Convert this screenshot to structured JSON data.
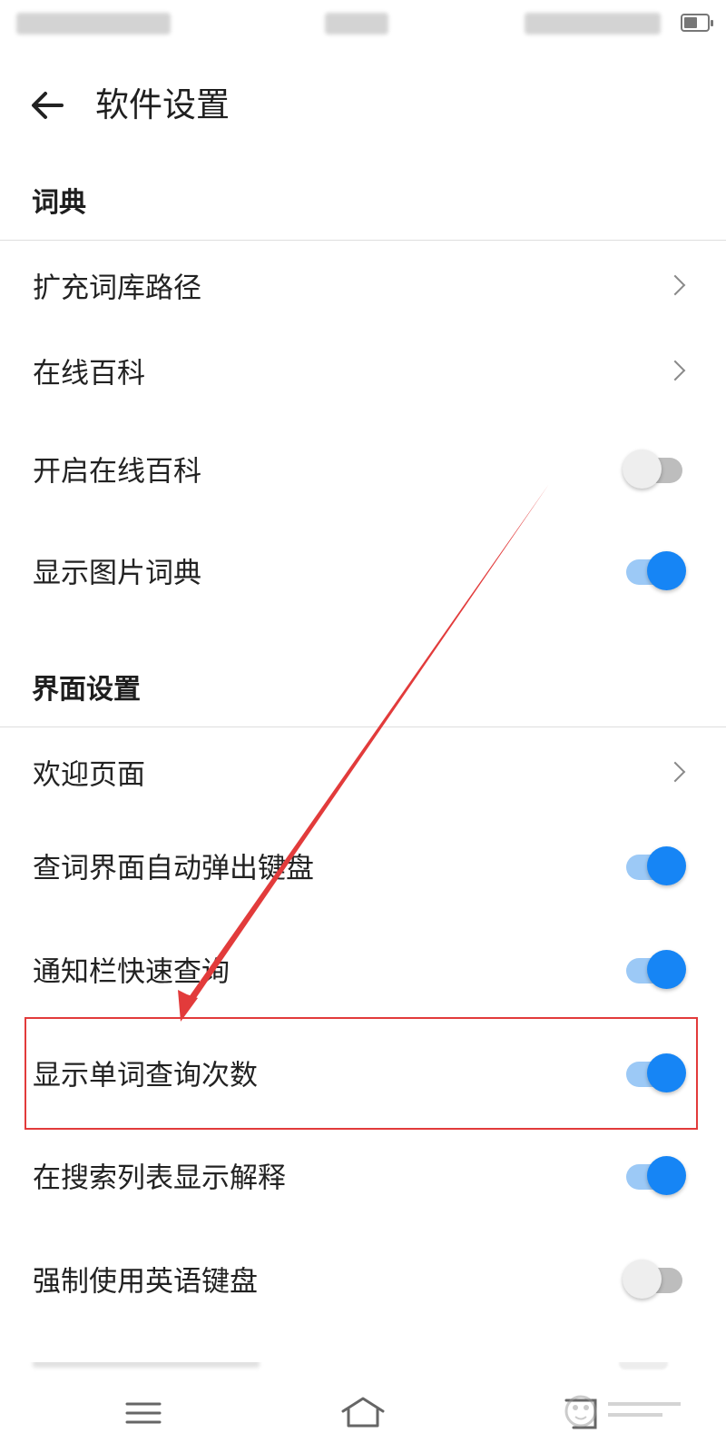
{
  "header": {
    "title": "软件设置"
  },
  "sections": [
    {
      "title": "词典",
      "items": [
        {
          "label": "扩充词库路径",
          "control": "chevron"
        },
        {
          "label": "在线百科",
          "control": "chevron"
        },
        {
          "label": "开启在线百科",
          "control": "toggle",
          "value": false
        },
        {
          "label": "显示图片词典",
          "control": "toggle",
          "value": true
        }
      ]
    },
    {
      "title": "界面设置",
      "items": [
        {
          "label": "欢迎页面",
          "control": "chevron"
        },
        {
          "label": "查词界面自动弹出键盘",
          "control": "toggle",
          "value": true
        },
        {
          "label": "通知栏快速查询",
          "control": "toggle",
          "value": true
        },
        {
          "label": "显示单词查询次数",
          "control": "toggle",
          "value": true
        },
        {
          "label": "在搜索列表显示解释",
          "control": "toggle",
          "value": true
        },
        {
          "label": "强制使用英语键盘",
          "control": "toggle",
          "value": false
        }
      ]
    }
  ],
  "colors": {
    "toggle_on_knob": "#1685f5",
    "toggle_on_track": "#9cc9f6",
    "toggle_off_knob": "#eeeeee",
    "toggle_off_track": "#bdbdbd",
    "annotation": "#e23b3b"
  },
  "icons": {
    "back": "arrow-left-icon",
    "chevron": "chevron-right-icon",
    "menu": "menu-icon",
    "home": "home-icon",
    "back_nav": "back-nav-icon"
  }
}
